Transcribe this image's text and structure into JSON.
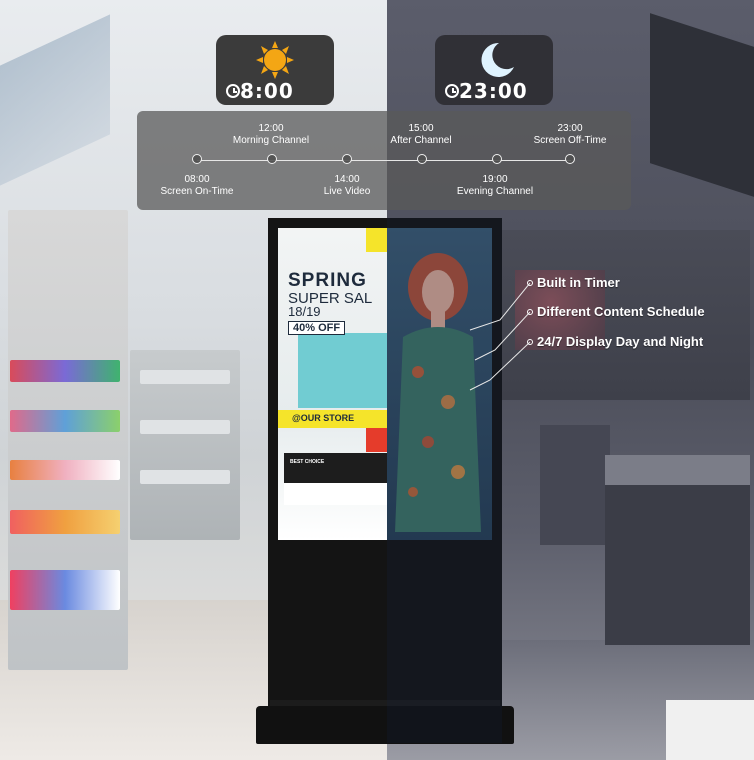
{
  "badges": {
    "day": {
      "time": "8:00",
      "icon": "sun-icon"
    },
    "night": {
      "time": "23:00",
      "icon": "moon-icon"
    }
  },
  "timeline": {
    "top": [
      {
        "time": "12:00",
        "label": "Morning Channel"
      },
      {
        "time": "15:00",
        "label": "After Channel"
      },
      {
        "time": "23:00",
        "label": "Screen Off-Time"
      }
    ],
    "bottom": [
      {
        "time": "08:00",
        "label": "Screen On-Time"
      },
      {
        "time": "14:00",
        "label": "Live Video"
      },
      {
        "time": "19:00",
        "label": "Evening Channel"
      }
    ]
  },
  "features": [
    "Built in Timer",
    "Different Content Schedule",
    "24/7 Display Day and Night"
  ],
  "poster": {
    "headline": "SPRING",
    "subline": "SUPER SAL",
    "date": "18/19",
    "discount": "40% OFF",
    "store": "@OUR STORE",
    "best": "BEST CHOICE"
  },
  "colors": {
    "sun": "#f4a614",
    "moon": "#dff3ff",
    "badge_bg": "#3b3b3b",
    "panel_bg": "#5a5a5a"
  }
}
